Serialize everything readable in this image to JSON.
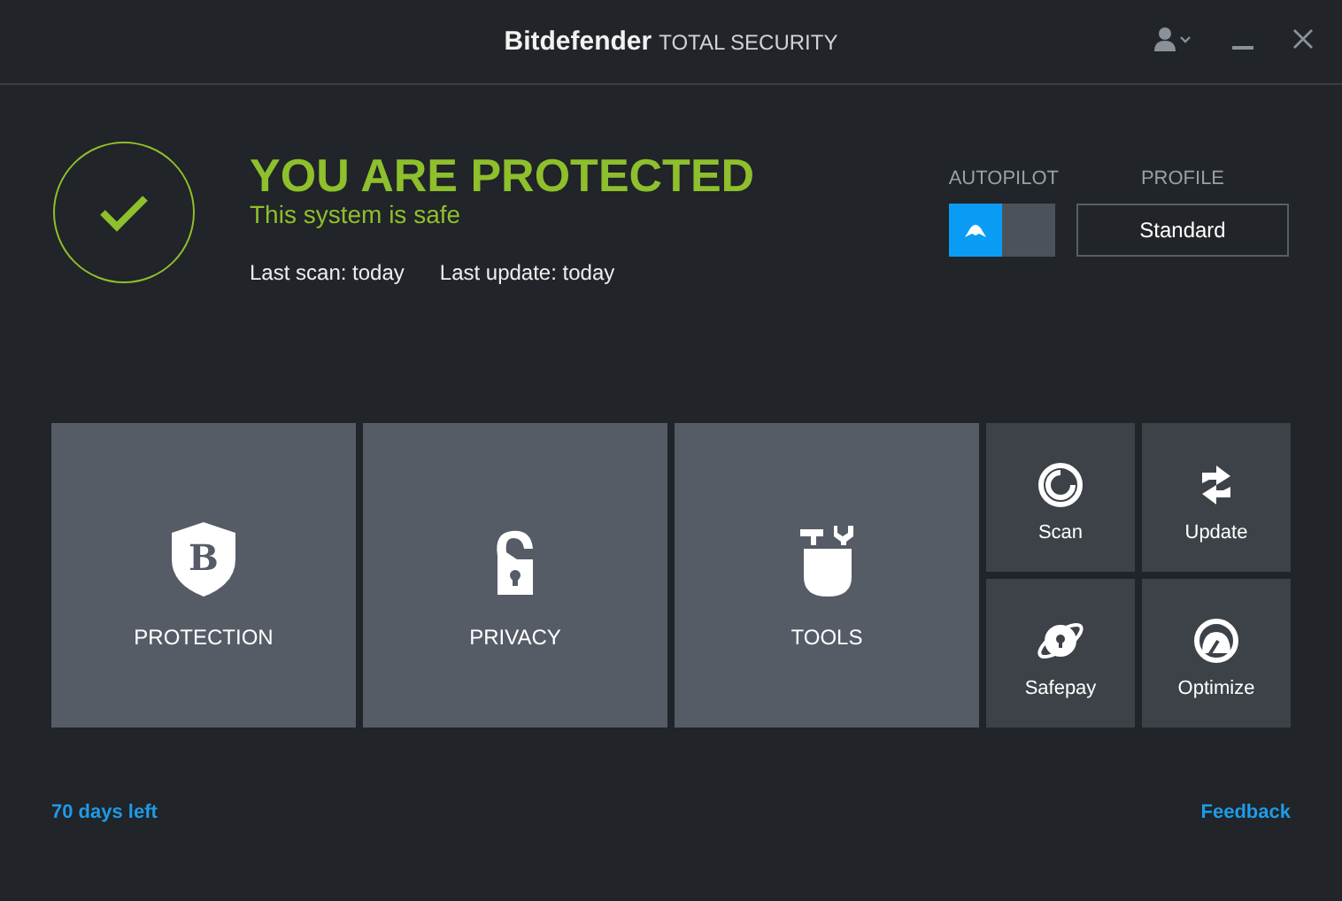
{
  "window": {
    "brand": "Bitdefender",
    "product": "TOTAL SECURITY"
  },
  "status": {
    "protected": true,
    "headline": "YOU ARE PROTECTED",
    "subtitle": "This system is safe",
    "last_scan": "Last scan: today",
    "last_update": "Last update: today"
  },
  "autopilot": {
    "label": "AUTOPILOT",
    "on": true
  },
  "profile": {
    "label": "PROFILE",
    "value": "Standard"
  },
  "modules": [
    {
      "kind": "protection",
      "label": "PROTECTION",
      "letter": "B"
    },
    {
      "kind": "privacy",
      "label": "PRIVACY"
    },
    {
      "kind": "tools",
      "label": "TOOLS"
    }
  ],
  "quick_actions": [
    {
      "kind": "scan",
      "label": "Scan"
    },
    {
      "kind": "update",
      "label": "Update"
    },
    {
      "kind": "safepay",
      "label": "Safepay"
    },
    {
      "kind": "optimize",
      "label": "Optimize"
    }
  ],
  "footer": {
    "days_left": "70 days left",
    "feedback": "Feedback"
  }
}
